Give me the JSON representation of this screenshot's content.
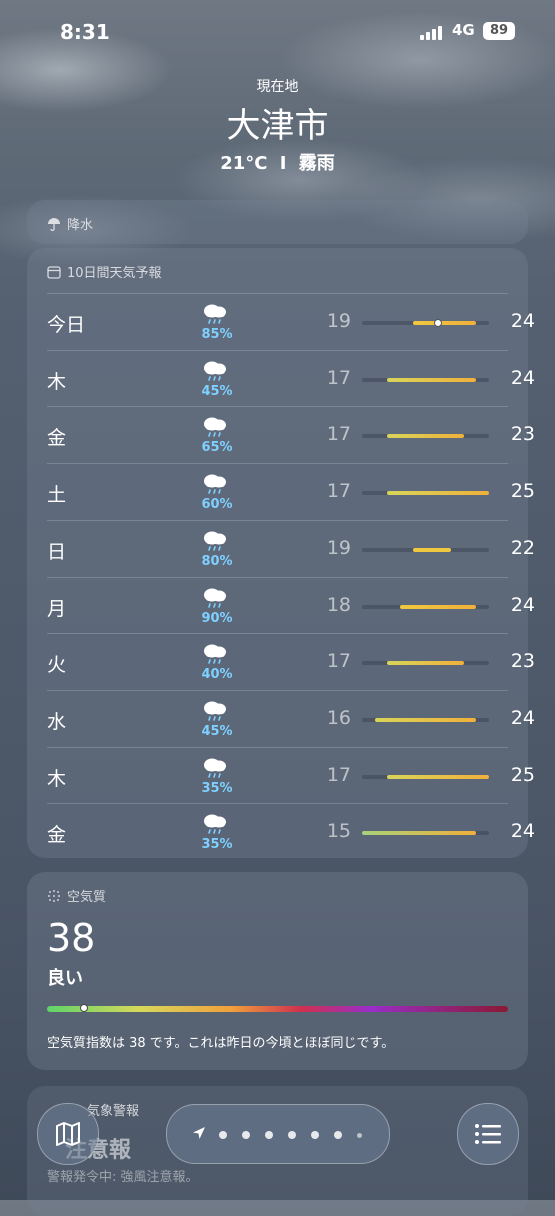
{
  "status_bar": {
    "time": "8:31",
    "network": "4G",
    "battery": "89"
  },
  "header": {
    "location_label": "現在地",
    "city": "大津市",
    "temperature": "21°C",
    "separator": "I",
    "condition": "霧雨"
  },
  "precip_card": {
    "title": "降水"
  },
  "forecast": {
    "title": "10日間天気予報",
    "range_min": 15,
    "range_max": 25,
    "current_temp": 21,
    "days": [
      {
        "day": "今日",
        "precip": "85%",
        "lo": 19,
        "hi": 24
      },
      {
        "day": "木",
        "precip": "45%",
        "lo": 17,
        "hi": 24
      },
      {
        "day": "金",
        "precip": "65%",
        "lo": 17,
        "hi": 23
      },
      {
        "day": "土",
        "precip": "60%",
        "lo": 17,
        "hi": 25
      },
      {
        "day": "日",
        "precip": "80%",
        "lo": 19,
        "hi": 22
      },
      {
        "day": "月",
        "precip": "90%",
        "lo": 18,
        "hi": 24
      },
      {
        "day": "火",
        "precip": "40%",
        "lo": 17,
        "hi": 23
      },
      {
        "day": "水",
        "precip": "45%",
        "lo": 16,
        "hi": 24
      },
      {
        "day": "木",
        "precip": "35%",
        "lo": 17,
        "hi": 25
      },
      {
        "day": "金",
        "precip": "35%",
        "lo": 15,
        "hi": 24
      }
    ]
  },
  "air_quality": {
    "title": "空気質",
    "value": "38",
    "category": "良い",
    "level_fraction": 0.08,
    "description": "空気質指数は 38 です。これは昨日の今頃とほぼ同じです。"
  },
  "alert_card": {
    "title": "気象警報",
    "headline": "注意報",
    "detail": "警報発令中: 強風注意報。"
  },
  "bottom_bar": {
    "page_count": 7,
    "active_page": 0
  }
}
